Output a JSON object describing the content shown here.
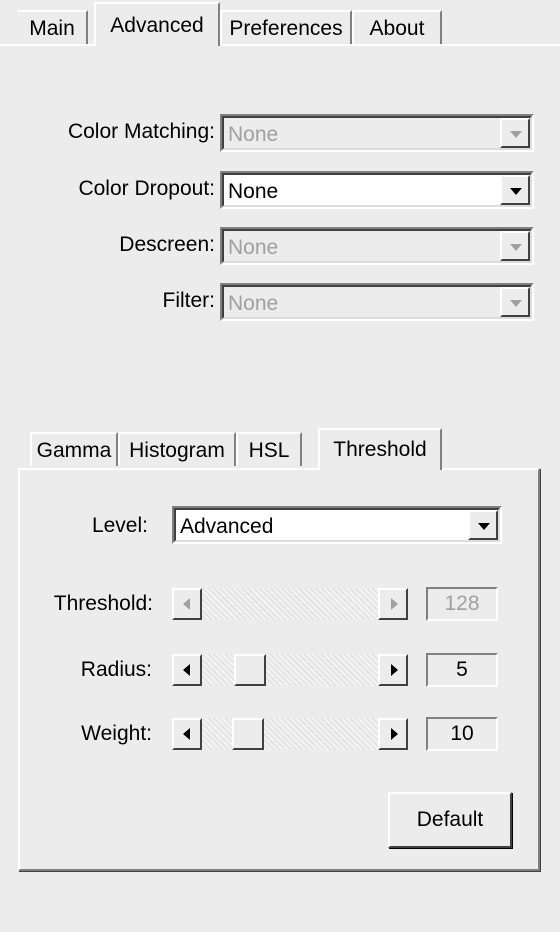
{
  "tabs": [
    "Main",
    "Advanced",
    "Preferences",
    "About"
  ],
  "active_tab": "Advanced",
  "fields": [
    {
      "label": "Color Matching:",
      "value": "None",
      "enabled": false
    },
    {
      "label": "Color Dropout:",
      "value": "None",
      "enabled": true
    },
    {
      "label": "Descreen:",
      "value": "None",
      "enabled": false
    },
    {
      "label": "Filter:",
      "value": "None",
      "enabled": false
    }
  ],
  "inner_tabs": [
    "Gamma",
    "Histogram",
    "HSL",
    "Threshold"
  ],
  "active_inner_tab": "Threshold",
  "level": {
    "label": "Level:",
    "value": "Advanced"
  },
  "sliders": [
    {
      "label": "Threshold:",
      "value": "128",
      "enabled": false
    },
    {
      "label": "Radius:",
      "value": "5",
      "enabled": true
    },
    {
      "label": "Weight:",
      "value": "10",
      "enabled": true
    }
  ],
  "default_button": "Default"
}
